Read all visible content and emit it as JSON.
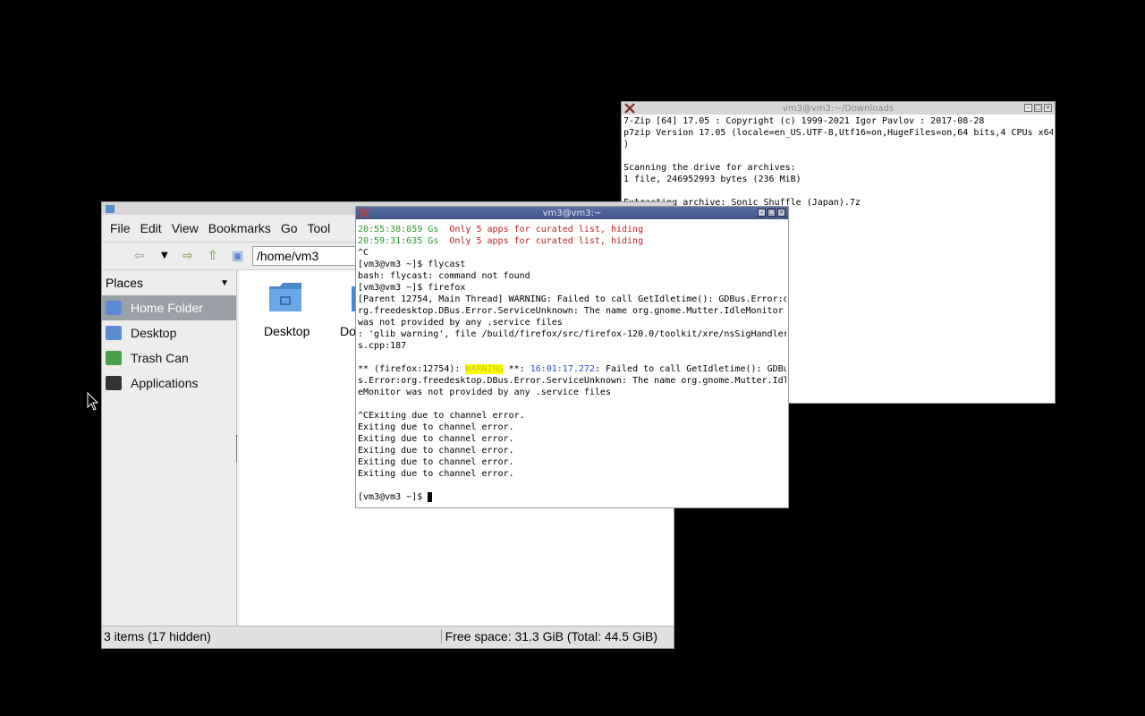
{
  "downloads_terminal": {
    "title": "vm3@vm3:~/Downloads",
    "lines": [
      "7-Zip [64] 17.05 : Copyright (c) 1999-2021 Igor Pavlov : 2017-08-28",
      "p7zip Version 17.05 (locale=en_US.UTF-8,Utf16=on,HugeFiles=on,64 bits,4 CPUs x64",
      ")",
      "",
      "Scanning the drive for archives:",
      "1 file, 246952993 bytes (236 MiB)",
      "",
      "Extracting archive: Sonic Shuffle (Japan).7z"
    ]
  },
  "file_manager": {
    "menu": [
      "File",
      "Edit",
      "View",
      "Bookmarks",
      "Go",
      "Tool"
    ],
    "path": "/home/vm3",
    "places_label": "Places",
    "places": [
      {
        "label": "Home Folder",
        "icon": "home-folder-icon",
        "selected": true
      },
      {
        "label": "Desktop",
        "icon": "desktop-folder-icon",
        "selected": false
      },
      {
        "label": "Trash Can",
        "icon": "trash-icon",
        "selected": false
      },
      {
        "label": "Applications",
        "icon": "applications-icon",
        "selected": false
      }
    ],
    "items": [
      "Desktop",
      "Do"
    ],
    "status_left": "3 items (17 hidden)",
    "status_right": "Free space: 31.3 GiB (Total: 44.5 GiB)"
  },
  "main_terminal": {
    "title": "vm3@vm3:~",
    "lines": [
      {
        "t": "20:55:38:859 Gs  ",
        "c": "green",
        "t2": "Only 5 apps for curated list, hiding",
        "c2": "red"
      },
      {
        "t": "20:59:31:635 Gs  ",
        "c": "green",
        "t2": "Only 5 apps for curated list, hiding",
        "c2": "red"
      },
      {
        "t": "^C"
      },
      {
        "t": "[vm3@vm3 ~]$ flycast"
      },
      {
        "t": "bash: flycast: command not found"
      },
      {
        "t": "[vm3@vm3 ~]$ firefox"
      },
      {
        "t": "[Parent 12754, Main Thread] WARNING: Failed to call GetIdletime(): GDBus.Error:o"
      },
      {
        "t": "rg.freedesktop.DBus.Error.ServiceUnknown: The name org.gnome.Mutter.IdleMonitor"
      },
      {
        "t": "was not provided by any .service files"
      },
      {
        "t": ": 'glib warning', file /build/firefox/src/firefox-120.0/toolkit/xre/nsSigHandler"
      },
      {
        "t": "s.cpp:187"
      },
      {
        "t": ""
      },
      {
        "t": "** (firefox:12754): ",
        "t2": "WARNING",
        "c2": "yellow",
        "t3": " **: ",
        "t4": "16:01:17.272",
        "c4": "blue",
        "t5": ": Failed to call GetIdletime(): GDBu"
      },
      {
        "t": "s.Error:org.freedesktop.DBus.Error.ServiceUnknown: The name org.gnome.Mutter.Idl"
      },
      {
        "t": "eMonitor was not provided by any .service files"
      },
      {
        "t": ""
      },
      {
        "t": "^CExiting due to channel error."
      },
      {
        "t": "Exiting due to channel error."
      },
      {
        "t": "Exiting due to channel error."
      },
      {
        "t": "Exiting due to channel error."
      },
      {
        "t": "Exiting due to channel error."
      },
      {
        "t": "Exiting due to channel error."
      },
      {
        "t": ""
      },
      {
        "t": "[vm3@vm3 ~]$ ",
        "cursor": true
      }
    ]
  }
}
